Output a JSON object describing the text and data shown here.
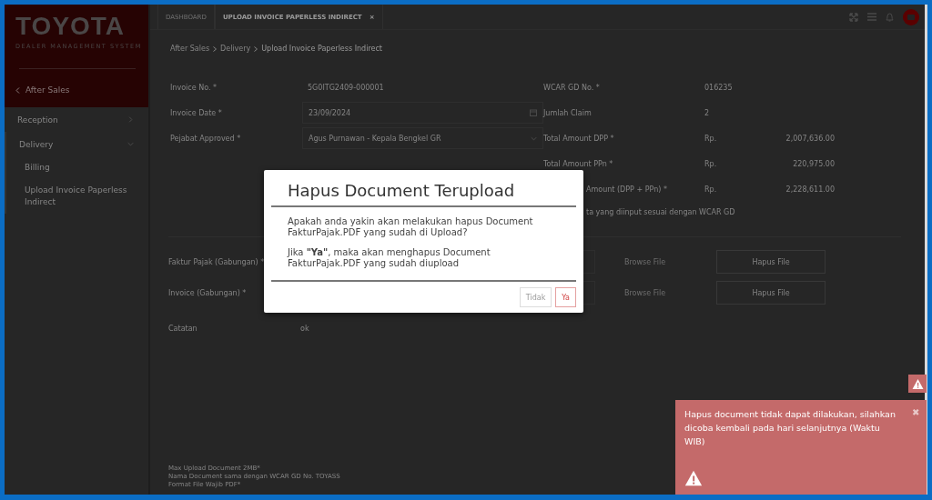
{
  "sidebar": {
    "logo": "TOYOTA",
    "subtitle": "DEALER MANAGEMENT SYSTEM",
    "back": "After Sales",
    "items": [
      {
        "label": "Reception",
        "expanded": false
      },
      {
        "label": "Delivery",
        "expanded": true,
        "children": [
          {
            "label": "Billing"
          },
          {
            "label": "Upload Invoice Paperless Indirect"
          }
        ]
      }
    ]
  },
  "tabs": [
    {
      "label": "DASHBOARD",
      "selected": false,
      "closable": false
    },
    {
      "label": "UPLOAD INVOICE PAPERLESS INDIRECT",
      "selected": true,
      "closable": true,
      "close": "×"
    }
  ],
  "breadcrumb": [
    "After Sales",
    "Delivery",
    "Upload Invoice Paperless Indirect"
  ],
  "form": {
    "left": [
      {
        "label": "Invoice No. *",
        "value": "5G0ITG2409-000001",
        "kind": "text"
      },
      {
        "label": "Invoice Date *",
        "value": "23/09/2024",
        "kind": "date"
      },
      {
        "label": "Pejabat Approved *",
        "value": "Agus Purnawan - Kepala Bengkel GR",
        "kind": "select"
      }
    ],
    "right": [
      {
        "label": "WCAR GD No. *",
        "value": "016235",
        "cut": false
      },
      {
        "label": "Jumlah Claim",
        "value": "2",
        "cut": false
      },
      {
        "label": "Total Amount DPP *",
        "currency": "Rp.",
        "value": "2,007,636.00",
        "cut": false
      },
      {
        "label": "Total Amount PPn *",
        "currency": "Rp.",
        "value": "220,975.00",
        "cut": false
      },
      {
        "label": "Amount (DPP + PPn) *",
        "currency": "Rp.",
        "value": "2,228,611.00",
        "cut": true
      }
    ],
    "note": "ta yang diinput sesuai dengan WCAR GD"
  },
  "uploads": [
    {
      "label": "Faktur Pajak (Gabungan) *",
      "browse": "Browse File",
      "delete": "Hapus File"
    },
    {
      "label": "Invoice (Gabungan) *",
      "browse": "Browse File",
      "delete": "Hapus File"
    }
  ],
  "remarks": {
    "label": "Catatan",
    "value": "ok"
  },
  "footnotes": [
    "Max Upload Document 2MB*",
    "Nama Document sama dengan WCAR GD No. TOYASS",
    "Format File Wajib PDF*"
  ],
  "dialog": {
    "title": "Hapus Document Terupload",
    "message": "Apakah anda yakin akan melakukan hapus Document FakturPajak.PDF yang sudah di Upload?",
    "warning": "Jika **\"Ya\"**, maka akan menghapus Document FakturPajak.PDF yang sudah diupload",
    "buttons": [
      {
        "label": "Tidak",
        "primary": false
      },
      {
        "label": "Ya",
        "primary": true
      }
    ]
  },
  "toast": {
    "message": "Hapus document tidak dapat dilakukan, silahkan dicoba kembali pada hari selanjutnya (Waktu WIB)",
    "close": "✖"
  }
}
